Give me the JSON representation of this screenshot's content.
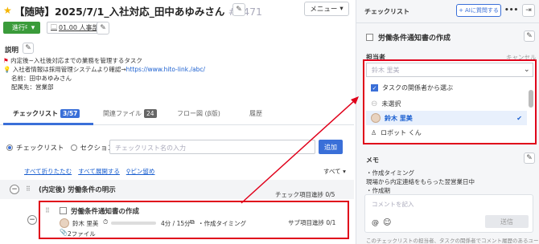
{
  "header": {
    "title": "【随時】2025/7/1_入社対応_田中あゆみさん",
    "ticket_no": "#8471",
    "menu_label": "メニュー",
    "status": "進行中",
    "department": "01.00 人事部"
  },
  "description": {
    "label": "説明",
    "lines": [
      "内定後~入社後対応までの業務を管理するタスク",
      "入社者情報は採用管理システムより確認→",
      "名前：田中あゆみさん",
      "配属先：営業部"
    ],
    "link": "https://www.hito-link./abc/"
  },
  "tabs": [
    {
      "label": "チェックリスト",
      "count": "3/57"
    },
    {
      "label": "関連ファイル",
      "count": "24"
    },
    {
      "label": "フロー図 (β版)",
      "count": ""
    },
    {
      "label": "履歴",
      "count": ""
    }
  ],
  "add_row": {
    "radio_checklist": "チェックリスト",
    "radio_section": "セクション",
    "placeholder": "チェックリスト名の入力",
    "add_label": "追加"
  },
  "links": {
    "collapse_all": "すべて折りたたむ",
    "expand_all": "すべて展開する",
    "pin_clear": "ピン留め",
    "all": "すべて"
  },
  "section": {
    "title": "(内定後) 労働条件の明示",
    "progress_label": "チェック項目進捗 0/5"
  },
  "task": {
    "title": "労働条件通知書の作成",
    "assignee": "鈴木 里美",
    "time": "4分 / 15分",
    "memo_preview": "・作成タイミング",
    "files": "2ファイル",
    "sub_progress": "サブ項目進捗 0/1",
    "progress": 0.0
  },
  "right_panel": {
    "title": "チェックリスト",
    "ai_label": "AIに質問する",
    "task_title": "労働条件通知書の作成",
    "assignee_label": "担当者",
    "cancel_label": "キャンセル",
    "search_placeholder": "鈴木 里美",
    "dropdown": {
      "related_only": "タスクの関係者から選ぶ",
      "options": [
        {
          "label": "未選択",
          "selected": false
        },
        {
          "label": "鈴木 里美",
          "selected": true
        },
        {
          "label": "ロボット くん",
          "selected": false
        }
      ]
    },
    "memo_label": "メモ",
    "memo_lines": [
      "・作成タイミング",
      "現場から内定連絡をもらった翌営業日中",
      "・作成期"
    ],
    "comment_placeholder": "コメントを記入",
    "send_label": "送信",
    "footer_note": "このチェックリストの担当者、タスクの関係者でコメント履歴のあるユー"
  },
  "colors": {
    "accent": "#3a6fd8",
    "status_green": "#3a9b3a",
    "highlight_red": "#e0001a"
  }
}
